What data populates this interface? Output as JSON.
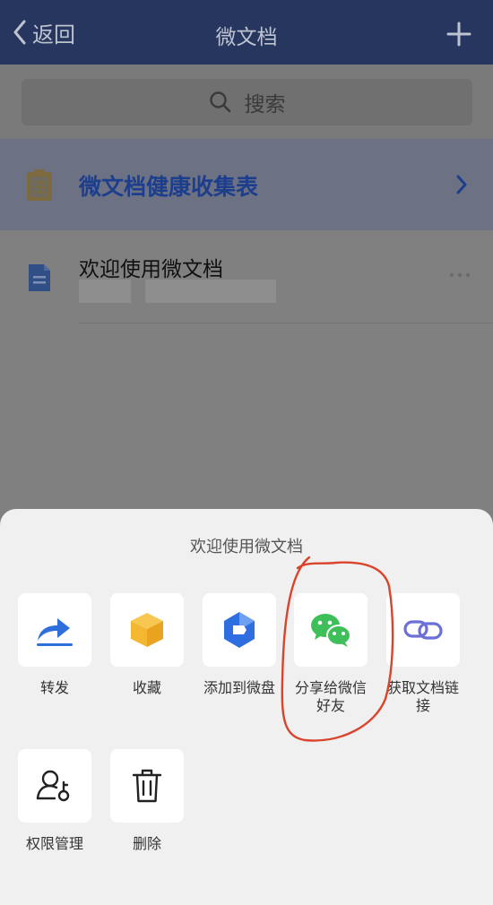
{
  "nav": {
    "back_label": "返回",
    "title": "微文档"
  },
  "search": {
    "label": "搜索"
  },
  "list": {
    "highlight_item": {
      "title": "微文档健康收集表"
    },
    "doc_item": {
      "title": "欢迎使用微文档"
    }
  },
  "sheet": {
    "title": "欢迎使用微文档",
    "actions": [
      {
        "label": "转发",
        "icon": "forward-arrow-icon"
      },
      {
        "label": "收藏",
        "icon": "favorite-box-icon"
      },
      {
        "label": "添加到微盘",
        "icon": "weipan-icon"
      },
      {
        "label": "分享给微信好友",
        "icon": "wechat-icon"
      },
      {
        "label": "获取文档链接",
        "icon": "link-icon"
      },
      {
        "label": "权限管理",
        "icon": "permission-user-key-icon"
      },
      {
        "label": "删除",
        "icon": "trash-icon"
      }
    ]
  },
  "colors": {
    "nav_bg": "#27365e",
    "highlight_title": "#1d3e8c",
    "wechat_green": "#3fbf5a",
    "annotation_red": "#d9442b",
    "forward_blue": "#2e6fdc",
    "weipan_blue": "#2f6ee0",
    "link_purple": "#6c6fd6",
    "favorite_yellow": "#f4b731"
  }
}
